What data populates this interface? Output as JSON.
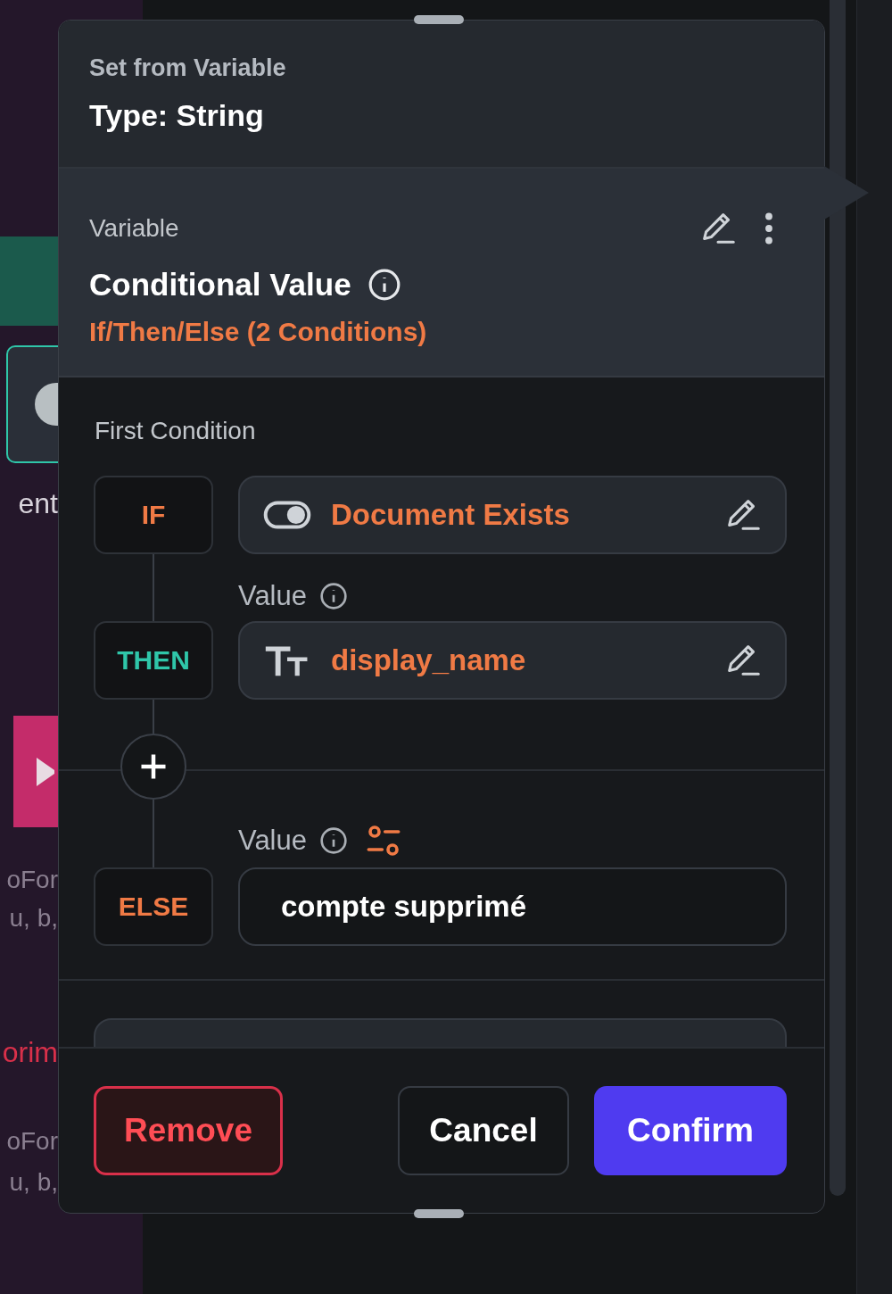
{
  "background_left": [
    {
      "text": "ent",
      "kind": "label"
    },
    {
      "text": "oFor",
      "kind": "muted"
    },
    {
      "text": "u, b,",
      "kind": "muted"
    },
    {
      "text": "orim",
      "kind": "error"
    },
    {
      "text": "oFor",
      "kind": "muted"
    },
    {
      "text": "u, b,",
      "kind": "muted"
    }
  ],
  "dialog": {
    "subtitle": "Set from Variable",
    "title": "Type: String"
  },
  "variable": {
    "label": "Variable",
    "name": "Conditional Value",
    "summary": "If/Then/Else (2 Conditions)"
  },
  "condition": {
    "title": "First Condition",
    "if": {
      "tag": "IF",
      "color": "#f07a45",
      "kind": "boolean",
      "value": "Document Exists"
    },
    "then": {
      "tag": "THEN",
      "color": "#2fc6a9",
      "label": "Value",
      "kind": "string",
      "value": "display_name"
    },
    "else": {
      "tag": "ELSE",
      "color": "#f07a45",
      "label": "Value",
      "kind": "literal",
      "value": "compte supprimé"
    }
  },
  "buttons": [
    {
      "label": "Remove",
      "kind": "danger"
    },
    {
      "label": "Cancel",
      "kind": "secondary"
    },
    {
      "label": "Confirm",
      "kind": "primary"
    }
  ]
}
